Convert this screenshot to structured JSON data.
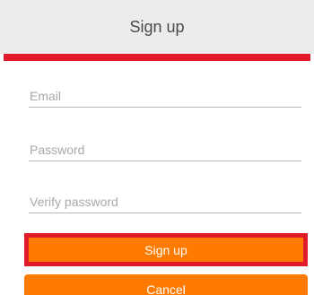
{
  "header": {
    "title": "Sign up"
  },
  "form": {
    "email": {
      "value": "",
      "placeholder": "Email"
    },
    "password": {
      "value": "",
      "placeholder": "Password"
    },
    "verify_password": {
      "value": "",
      "placeholder": "Verify password"
    }
  },
  "buttons": {
    "signup_label": "Sign up",
    "cancel_label": "Cancel"
  },
  "colors": {
    "header_bg": "#ececec",
    "accent_red": "#e01b2a",
    "button_orange": "#ff7a00"
  }
}
